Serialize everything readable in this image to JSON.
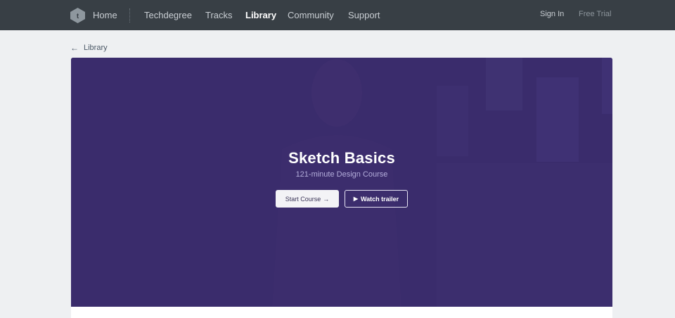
{
  "nav": {
    "home": "Home",
    "links": [
      "Techdegree",
      "Tracks",
      "Library",
      "Community",
      "Support"
    ],
    "active": "Library",
    "sign_in": "Sign In",
    "free_trial": "Free Trial",
    "logo_icon": "treehouse-logo-icon"
  },
  "breadcrumb": {
    "icon": "arrow-left-icon",
    "label": "Library"
  },
  "hero": {
    "title": "Sketch Basics",
    "subtitle": "121-minute Design Course",
    "start_button": "Start Course",
    "start_icon": "arrow-right-icon",
    "trailer_button": "Watch trailer",
    "trailer_icon": "play-icon",
    "background_color": "#3a2c6c"
  },
  "colors": {
    "nav_bg": "#383f45",
    "page_bg": "#eef0f2",
    "hero_bg": "#3a2c6c"
  }
}
